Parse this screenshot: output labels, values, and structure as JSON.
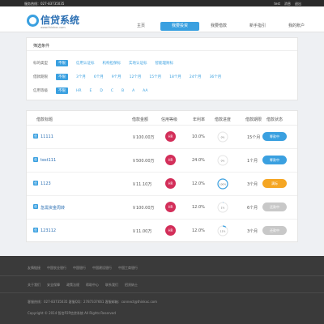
{
  "topbar": {
    "hotline": "服务热线：027-83735035",
    "user": "test",
    "message": "消息",
    "logout": "退出"
  },
  "header": {
    "logo_text": "信贷系统",
    "logo_sub": "www.thinkxc.com"
  },
  "nav": [
    "主页",
    "我要投资",
    "我要借款",
    "新手指引",
    "我的账户"
  ],
  "nav_active_index": 1,
  "filter": {
    "title": "筛选条件",
    "rows": [
      {
        "label": "标的类型",
        "options": [
          "不限",
          "信用认证标",
          "机构担保标",
          "实地认证标",
          "智能理财标"
        ],
        "selected": 0
      },
      {
        "label": "借款期限",
        "options": [
          "不限",
          "3个月",
          "6个月",
          "9个月",
          "12个月",
          "15个月",
          "18个月",
          "24个月",
          "36个月"
        ],
        "selected": 0
      },
      {
        "label": "信用等级",
        "options": [
          "不限",
          "HR",
          "E",
          "D",
          "C",
          "B",
          "A",
          "AA"
        ],
        "selected": 0
      }
    ]
  },
  "table": {
    "headers": [
      "借款标题",
      "借款金额",
      "信用等级",
      "年利率",
      "借款进度",
      "借款期限",
      "借款状态"
    ],
    "rows": [
      {
        "icon": "信",
        "title": "11111",
        "amount": "￥100.00万",
        "credit": "HR",
        "rate": "10.0%",
        "progress": 0,
        "progress_label": "0%",
        "term": "15个月",
        "status": "筹款中",
        "status_color": "blue"
      },
      {
        "icon": "信",
        "title": "test111",
        "amount": "￥500.00万",
        "credit": "HR",
        "rate": "24.0%",
        "progress": 0,
        "progress_label": "0%",
        "term": "1个月",
        "status": "筹款中",
        "status_color": "blue"
      },
      {
        "icon": "信",
        "title": "1123",
        "amount": "￥11.10万",
        "credit": "HR",
        "rate": "12.0%",
        "progress": 100,
        "progress_label": "100%",
        "term": "3个月",
        "status": "满标",
        "status_color": "orange"
      },
      {
        "icon": "信",
        "title": "急需资金周转",
        "amount": "￥100.00万",
        "credit": "HR",
        "rate": "12.0%",
        "progress": 1,
        "progress_label": "1%",
        "term": "6个月",
        "status": "还款中",
        "status_color": "grey"
      },
      {
        "icon": "信",
        "title": "123112",
        "amount": "￥11.00万",
        "credit": "HR",
        "rate": "12.0%",
        "progress": 11,
        "progress_label": "11%",
        "term": "3个月",
        "status": "还款中",
        "status_color": "grey"
      }
    ]
  },
  "footer": {
    "row1": [
      "友情链接",
      "中国农业银行",
      "中国银行",
      "中国建设银行",
      "中国工商银行"
    ],
    "row2": [
      "关于我们",
      "安全保障",
      "政策法规",
      "帮助中心",
      "联系我们",
      "招贤纳士"
    ],
    "contact": "客服热线：027-83735035    客服QQ：2787337661    客服邮箱：connect@thinkxc.com",
    "copyright": "Copyright © 2014 智信P2P信贷系统 All Rights Reserved"
  },
  "colors": {
    "accent": "#3aa0e0",
    "credit_badge": "#d32f5a",
    "full_status": "#f5a623"
  }
}
